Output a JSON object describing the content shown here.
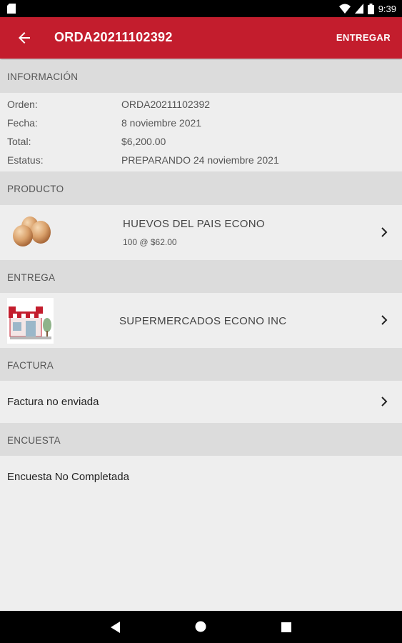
{
  "status_bar": {
    "time": "9:39"
  },
  "app_bar": {
    "title": "ORDA20211102392",
    "action_label": "ENTREGAR"
  },
  "info": {
    "header": "INFORMACIÓN",
    "rows": [
      {
        "label": "Orden:",
        "value": "ORDA20211102392"
      },
      {
        "label": "Fecha:",
        "value": "8 noviembre 2021"
      },
      {
        "label": "Total:",
        "value": "$6,200.00"
      },
      {
        "label": "Estatus:",
        "value": "PREPARANDO 24 noviembre 2021"
      }
    ]
  },
  "product": {
    "header": "PRODUCTO",
    "name": "HUEVOS DEL PAIS ECONO",
    "detail": "100 @ $62.00"
  },
  "delivery": {
    "header": "ENTREGA",
    "store_name": "SUPERMERCADOS ECONO INC"
  },
  "invoice": {
    "header": "FACTURA",
    "text": "Factura no enviada"
  },
  "survey": {
    "header": "ENCUESTA",
    "text": "Encuesta No Completada"
  }
}
